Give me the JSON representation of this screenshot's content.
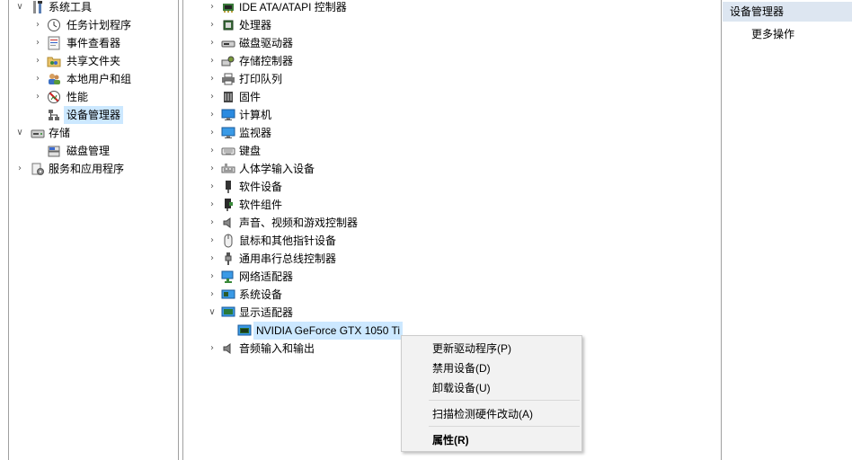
{
  "left_tree": [
    {
      "id": "system-tools",
      "label": "系统工具",
      "arrow": "expanded",
      "icon": "tools-icon"
    },
    {
      "id": "task-scheduler",
      "label": "任务计划程序",
      "arrow": "collapsed",
      "icon": "clock-icon"
    },
    {
      "id": "event-viewer",
      "label": "事件查看器",
      "arrow": "collapsed",
      "icon": "event-log-icon"
    },
    {
      "id": "shared-folders",
      "label": "共享文件夹",
      "arrow": "collapsed",
      "icon": "shared-folder-icon"
    },
    {
      "id": "local-users",
      "label": "本地用户和组",
      "arrow": "collapsed",
      "icon": "users-icon"
    },
    {
      "id": "performance",
      "label": "性能",
      "arrow": "collapsed",
      "icon": "performance-icon"
    },
    {
      "id": "device-manager",
      "label": "设备管理器",
      "arrow": "none",
      "icon": "device-manager-icon",
      "selected": true
    },
    {
      "id": "storage",
      "label": "存储",
      "arrow": "expanded",
      "icon": "storage-icon"
    },
    {
      "id": "disk-management",
      "label": "磁盘管理",
      "arrow": "none",
      "icon": "disk-management-icon"
    },
    {
      "id": "services-apps",
      "label": "服务和应用程序",
      "arrow": "collapsed",
      "icon": "services-icon"
    }
  ],
  "device_tree": [
    {
      "id": "ide",
      "label": "IDE ATA/ATAPI 控制器",
      "arrow": "collapsed",
      "icon": "ide-controller-icon"
    },
    {
      "id": "processor",
      "label": "处理器",
      "arrow": "collapsed",
      "icon": "processor-icon"
    },
    {
      "id": "disk-drives",
      "label": "磁盘驱动器",
      "arrow": "collapsed",
      "icon": "disk-drive-icon"
    },
    {
      "id": "storage-controllers",
      "label": "存储控制器",
      "arrow": "collapsed",
      "icon": "storage-controller-icon"
    },
    {
      "id": "print-queues",
      "label": "打印队列",
      "arrow": "collapsed",
      "icon": "printer-icon"
    },
    {
      "id": "firmware",
      "label": "固件",
      "arrow": "collapsed",
      "icon": "firmware-icon"
    },
    {
      "id": "computer",
      "label": "计算机",
      "arrow": "collapsed",
      "icon": "computer-icon"
    },
    {
      "id": "monitors",
      "label": "监视器",
      "arrow": "collapsed",
      "icon": "monitor-icon"
    },
    {
      "id": "keyboards",
      "label": "键盘",
      "arrow": "collapsed",
      "icon": "keyboard-icon"
    },
    {
      "id": "hid",
      "label": "人体学输入设备",
      "arrow": "collapsed",
      "icon": "hid-icon"
    },
    {
      "id": "software-devices",
      "label": "软件设备",
      "arrow": "collapsed",
      "icon": "software-device-icon"
    },
    {
      "id": "software-components",
      "label": "软件组件",
      "arrow": "collapsed",
      "icon": "software-component-icon"
    },
    {
      "id": "sound",
      "label": "声音、视频和游戏控制器",
      "arrow": "collapsed",
      "icon": "speaker-icon"
    },
    {
      "id": "mice",
      "label": "鼠标和其他指针设备",
      "arrow": "collapsed",
      "icon": "mouse-icon"
    },
    {
      "id": "usb",
      "label": "通用串行总线控制器",
      "arrow": "collapsed",
      "icon": "usb-icon"
    },
    {
      "id": "network",
      "label": "网络适配器",
      "arrow": "collapsed",
      "icon": "network-adapter-icon"
    },
    {
      "id": "system-devices",
      "label": "系统设备",
      "arrow": "collapsed",
      "icon": "system-device-icon"
    },
    {
      "id": "display-adapters",
      "label": "显示适配器",
      "arrow": "expanded",
      "icon": "display-adapter-icon"
    },
    {
      "id": "gpu",
      "label": "NVIDIA GeForce GTX 1050 Ti",
      "arrow": "none",
      "icon": "gpu-icon",
      "child": true,
      "selected": true
    },
    {
      "id": "audio-io",
      "label": "音频输入和输出",
      "arrow": "collapsed",
      "icon": "speaker-icon"
    }
  ],
  "actions": {
    "header": "设备管理器",
    "more": "更多操作"
  },
  "context_menu": {
    "update_driver": "更新驱动程序(P)",
    "disable_device": "禁用设备(D)",
    "uninstall_device": "卸载设备(U)",
    "scan_changes": "扫描检测硬件改动(A)",
    "properties": "属性(R)"
  },
  "colors": {
    "selection": "#cce8ff",
    "actions_header": "#dde6f1",
    "menu_bg": "#f2f2f2"
  }
}
